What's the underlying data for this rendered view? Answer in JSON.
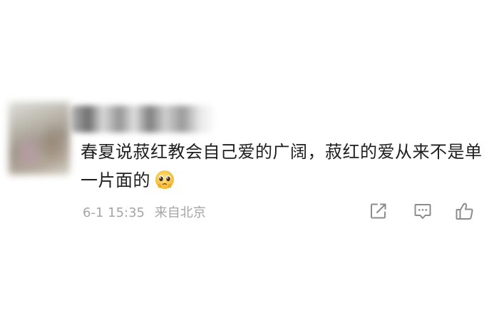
{
  "comment": {
    "avatar_icon": "blurred-avatar",
    "username_icon": "blurred-username",
    "text": "春夏说菽红教会自己爱的广阔，菽红的爱从来不是单一片面的",
    "emoji_icon": "pleading-face-emoji",
    "timestamp": "6-1 15:35",
    "location": "来自北京"
  },
  "actions": {
    "share_icon": "share-icon",
    "reply_icon": "comment-icon",
    "like_icon": "thumbs-up-icon"
  },
  "colors": {
    "text": "#1e1e1e",
    "meta": "#a5a5a5",
    "icon": "#8c8c8c",
    "background": "#ffffff"
  }
}
